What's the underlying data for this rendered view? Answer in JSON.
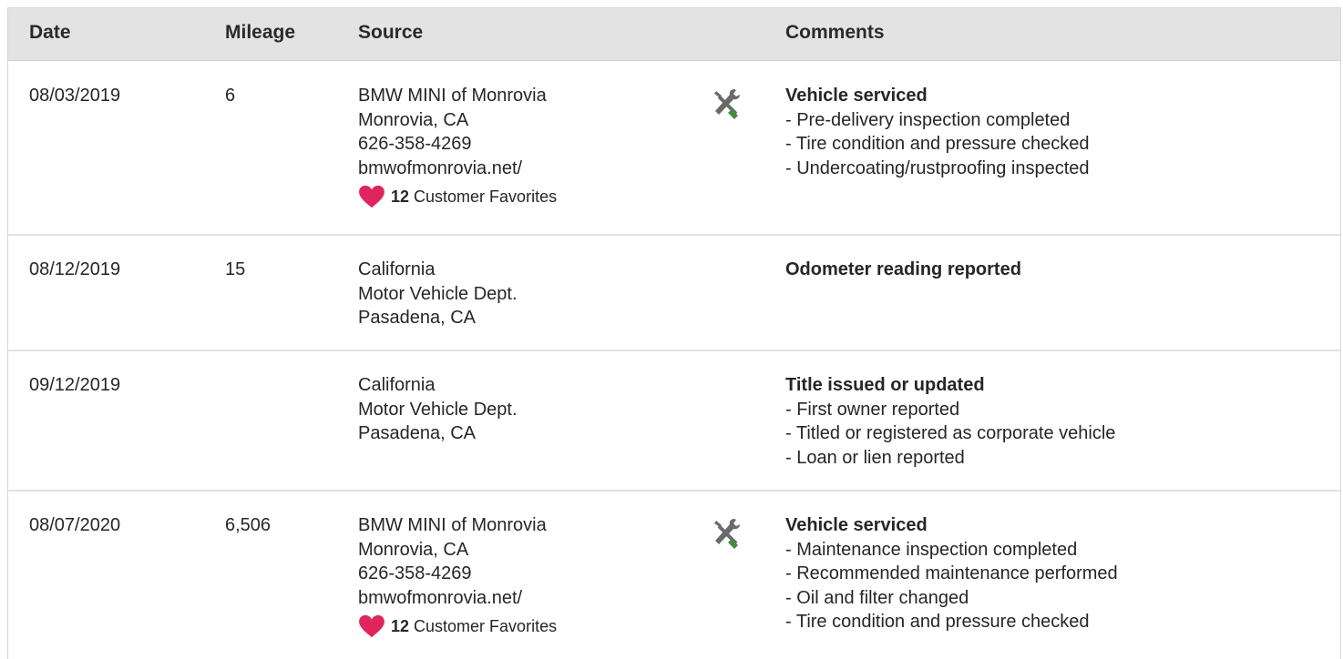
{
  "columns": {
    "date": "Date",
    "mileage": "Mileage",
    "source": "Source",
    "comments": "Comments"
  },
  "colors": {
    "header_bg": "#e3e3e3",
    "heart": "#e0245e",
    "wrench_green": "#3f8f3a",
    "tool_gray": "#6a6a6a"
  },
  "rows": [
    {
      "date": "08/03/2019",
      "mileage": "6",
      "source": [
        "BMW MINI of Monrovia",
        "Monrovia, CA",
        "626-358-4269",
        "bmwofmonrovia.net/"
      ],
      "favorites_count": "12",
      "favorites_label": "Customer Favorites",
      "icon": "service-tools-icon",
      "comment_title": "Vehicle serviced",
      "comment_items": [
        "- Pre-delivery inspection completed",
        "- Tire condition and pressure checked",
        "- Undercoating/rustproofing inspected"
      ]
    },
    {
      "date": "08/12/2019",
      "mileage": "15",
      "source": [
        "California",
        "Motor Vehicle Dept.",
        "Pasadena, CA"
      ],
      "comment_title": "Odometer reading reported",
      "comment_items": []
    },
    {
      "date": "09/12/2019",
      "mileage": "",
      "source": [
        "California",
        "Motor Vehicle Dept.",
        "Pasadena, CA"
      ],
      "comment_title": "Title issued or updated",
      "comment_items": [
        "- First owner reported",
        "- Titled or registered as corporate vehicle",
        "- Loan or lien reported"
      ]
    },
    {
      "date": "08/07/2020",
      "mileage": "6,506",
      "source": [
        "BMW MINI of Monrovia",
        "Monrovia, CA",
        "626-358-4269",
        "bmwofmonrovia.net/"
      ],
      "favorites_count": "12",
      "favorites_label": "Customer Favorites",
      "icon": "service-tools-icon",
      "comment_title": "Vehicle serviced",
      "comment_items": [
        "- Maintenance inspection completed",
        "- Recommended maintenance performed",
        "- Oil and filter changed",
        "- Tire condition and pressure checked"
      ]
    }
  ]
}
